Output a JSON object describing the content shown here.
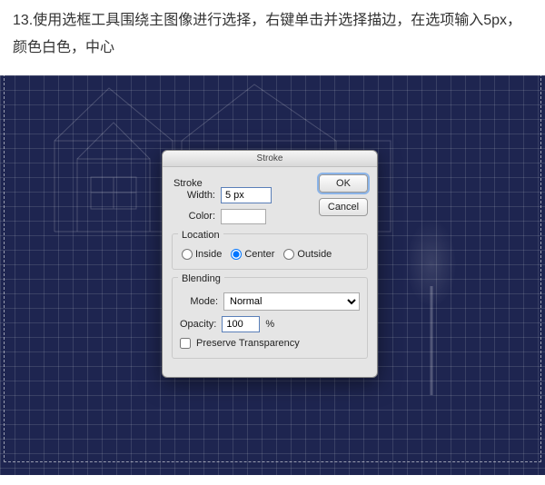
{
  "instruction": "13.使用选框工具围绕主图像进行选择，右键单击并选择描边，在选项输入5px，颜色白色，中心",
  "dialog": {
    "title": "Stroke",
    "stroke": {
      "legend": "Stroke",
      "width_label": "Width:",
      "width_value": "5 px",
      "color_label": "Color:"
    },
    "location": {
      "legend": "Location",
      "options": {
        "inside": "Inside",
        "center": "Center",
        "outside": "Outside"
      },
      "selected": "center"
    },
    "blending": {
      "legend": "Blending",
      "mode_label": "Mode:",
      "mode_value": "Normal",
      "opacity_label": "Opacity:",
      "opacity_value": "100",
      "opacity_unit": "%",
      "preserve_label": "Preserve Transparency"
    },
    "buttons": {
      "ok": "OK",
      "cancel": "Cancel"
    }
  }
}
